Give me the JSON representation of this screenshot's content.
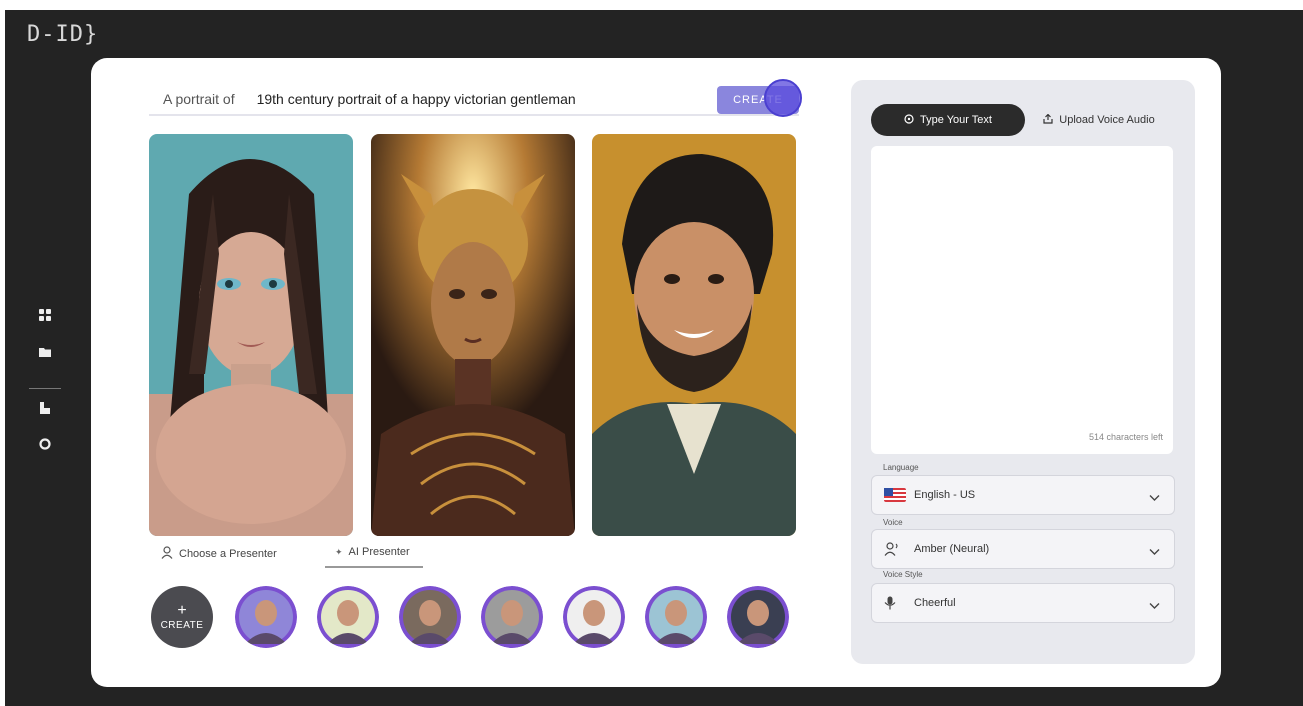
{
  "app": {
    "logo_text": "D-ID}"
  },
  "sidebar": {
    "items": [
      {
        "name": "dashboard",
        "icon": "grid-icon"
      },
      {
        "name": "library",
        "icon": "folder-icon"
      },
      {
        "name": "docs",
        "icon": "file-icon"
      },
      {
        "name": "settings",
        "icon": "circle-icon"
      }
    ]
  },
  "prompt": {
    "label": "A portrait of",
    "value": "19th century portrait of a happy victorian gentleman",
    "create_label": "CREATE"
  },
  "gallery": {
    "portraits": [
      {
        "name": "portrait-woman-teal"
      },
      {
        "name": "portrait-golden-alien"
      },
      {
        "name": "portrait-victorian-gentleman"
      }
    ]
  },
  "presenter_tabs": {
    "choose": "Choose a Presenter",
    "ai": "AI Presenter",
    "active": "ai"
  },
  "avatars": {
    "create_plus": "+",
    "create_label": "CREATE",
    "items": [
      {
        "name": "avatar-red-hair-cartoon",
        "bg": "#8f86d8"
      },
      {
        "name": "avatar-man-orange-shirt",
        "bg": "#e3e8c8"
      },
      {
        "name": "avatar-man-orange-hair",
        "bg": "#7a6a5e"
      },
      {
        "name": "avatar-robot-man",
        "bg": "#9c9c9c"
      },
      {
        "name": "avatar-woman-afro",
        "bg": "#efefef"
      },
      {
        "name": "avatar-red-hair-woman",
        "bg": "#9cc4d4"
      },
      {
        "name": "avatar-fantasy-woman",
        "bg": "#3a3f52"
      }
    ]
  },
  "script_panel": {
    "tab_text": "Type Your Text",
    "tab_audio": "Upload Voice Audio",
    "text_value": "",
    "chars_left": "514 characters left",
    "language": {
      "label": "Language",
      "value": "English - US",
      "icon": "us-flag-icon"
    },
    "voice": {
      "label": "Voice",
      "value": "Amber (Neural)",
      "icon": "person-voice-icon"
    },
    "voice_style": {
      "label": "Voice Style",
      "value": "Cheerful",
      "icon": "mic-icon"
    }
  },
  "colors": {
    "accent": "#8a86dd",
    "cursor": "#4a3fd0",
    "avatar_ring": "#7b4fd0"
  }
}
